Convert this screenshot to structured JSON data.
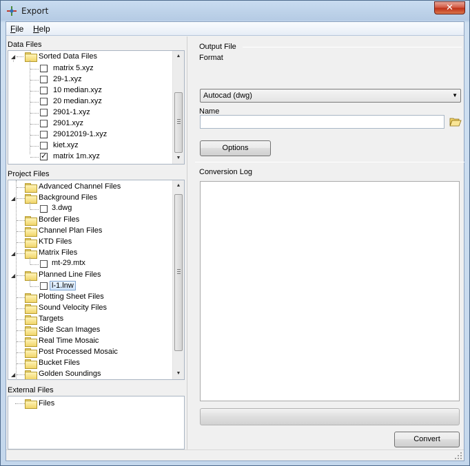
{
  "window": {
    "title": "Export"
  },
  "menu": {
    "items": [
      {
        "label": "File",
        "mnemonic": "F",
        "rest": "ile"
      },
      {
        "label": "Help",
        "mnemonic": "H",
        "rest": "elp"
      }
    ]
  },
  "data_files": {
    "title": "Data Files",
    "folder": "Sorted Data Files",
    "items": [
      {
        "label": "matrix 5.xyz",
        "checked": false
      },
      {
        "label": "29-1.xyz",
        "checked": false
      },
      {
        "label": "10 median.xyz",
        "checked": false
      },
      {
        "label": "20 median.xyz",
        "checked": false
      },
      {
        "label": "2901-1.xyz",
        "checked": false
      },
      {
        "label": "2901.xyz",
        "checked": false
      },
      {
        "label": "29012019-1.xyz",
        "checked": false
      },
      {
        "label": "kiet.xyz",
        "checked": false
      },
      {
        "label": "matrix 1m.xyz",
        "checked": true,
        "check_glyph": "✓"
      }
    ]
  },
  "project_files": {
    "title": "Project Files",
    "rows": [
      {
        "label": "Advanced Channel Files",
        "type": "folder",
        "expanded": false
      },
      {
        "label": "Background Files",
        "type": "folder",
        "expanded": true
      },
      {
        "label": "3.dwg",
        "type": "file"
      },
      {
        "label": "Border Files",
        "type": "folder",
        "expanded": false
      },
      {
        "label": "Channel Plan Files",
        "type": "folder",
        "expanded": false
      },
      {
        "label": "KTD Files",
        "type": "folder",
        "expanded": false
      },
      {
        "label": "Matrix Files",
        "type": "folder",
        "expanded": true
      },
      {
        "label": "mt-29.mtx",
        "type": "file"
      },
      {
        "label": "Planned Line Files",
        "type": "folder",
        "expanded": true
      },
      {
        "label": "l-1.lnw",
        "type": "file",
        "selected": true
      },
      {
        "label": "Plotting Sheet Files",
        "type": "folder",
        "expanded": false
      },
      {
        "label": "Sound Velocity Files",
        "type": "folder",
        "expanded": false
      },
      {
        "label": "Targets",
        "type": "folder",
        "expanded": false
      },
      {
        "label": "Side Scan Images",
        "type": "folder",
        "expanded": false
      },
      {
        "label": "Real Time Mosaic",
        "type": "folder",
        "expanded": false
      },
      {
        "label": "Post Processed Mosaic",
        "type": "folder",
        "expanded": false
      },
      {
        "label": "Bucket Files",
        "type": "folder",
        "expanded": false
      },
      {
        "label": "Golden Soundings",
        "type": "folder",
        "expanded": true
      }
    ]
  },
  "external_files": {
    "title": "External Files",
    "folder": "Files"
  },
  "output": {
    "group_title": "Output File",
    "format_label": "Format",
    "format_value": "Autocad (dwg)",
    "name_label": "Name",
    "name_value": "",
    "options_button": "Options"
  },
  "log": {
    "title": "Conversion Log",
    "content": ""
  },
  "progress": {
    "percent": 0
  },
  "convert_button": "Convert",
  "icons": {
    "app": "export-app-icon",
    "close": "close-icon",
    "expand": "expand-triangle-icon",
    "folder": "folder-icon",
    "browse": "open-folder-icon",
    "dropdown": "chevron-down-icon"
  },
  "colors": {
    "close_button": "#c7442d",
    "selection": "#cfe4fb"
  }
}
